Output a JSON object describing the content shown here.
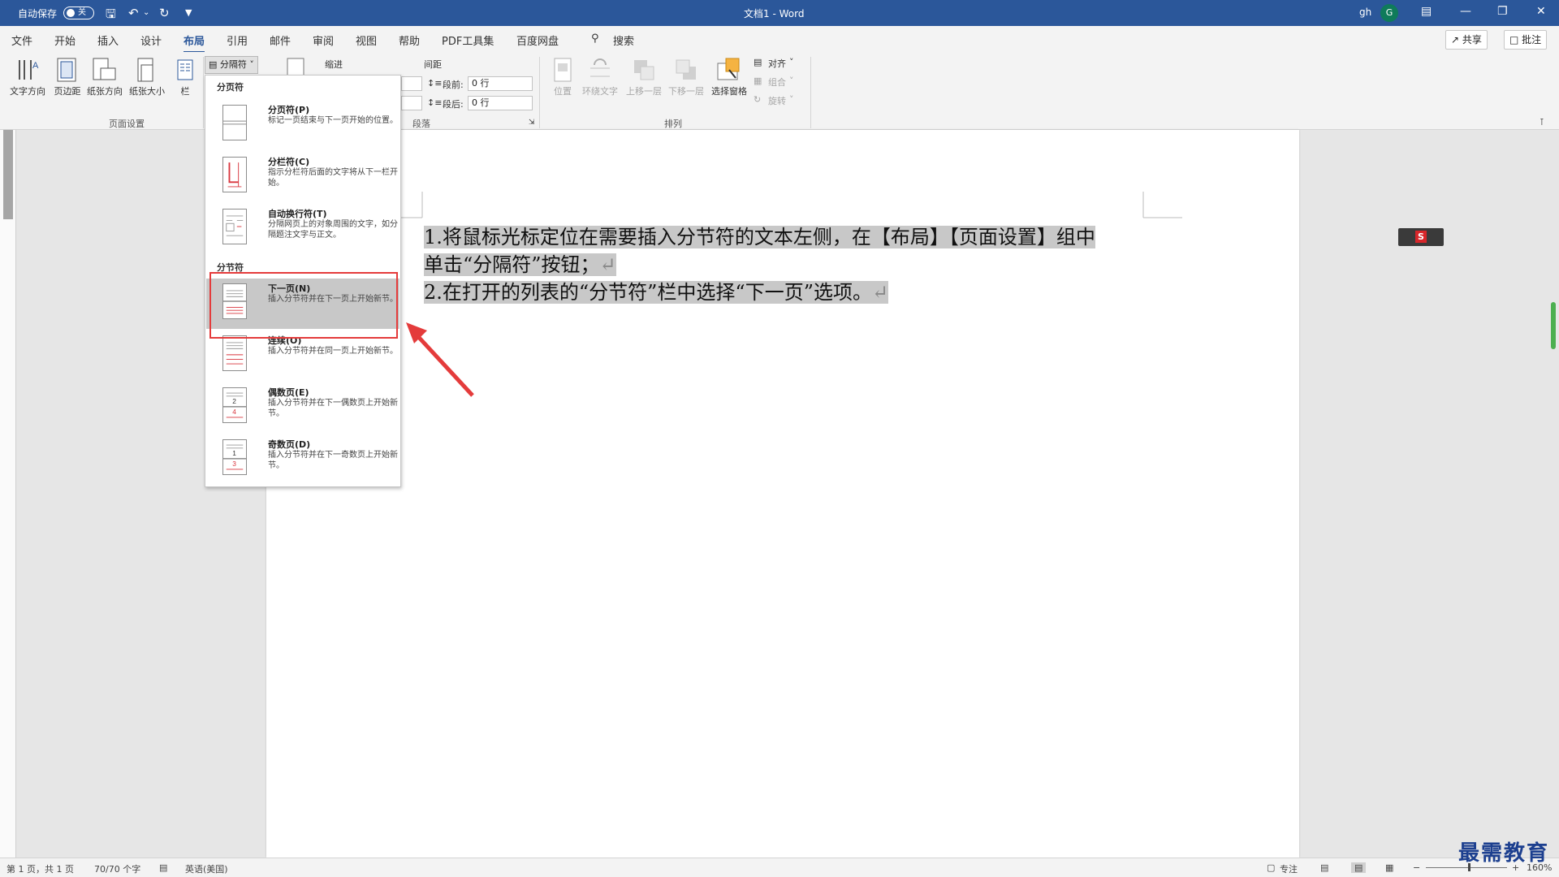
{
  "titlebar": {
    "autosave_label": "自动保存",
    "autosave_state": "关",
    "doc_title": "文档1 - Word",
    "user": "gh",
    "avatar_initial": "G"
  },
  "tabs": [
    "文件",
    "开始",
    "插入",
    "设计",
    "布局",
    "引用",
    "邮件",
    "审阅",
    "视图",
    "帮助",
    "PDF工具集",
    "百度网盘"
  ],
  "search_label": "搜索",
  "share_label": "共享",
  "comment_label": "批注",
  "ribbon": {
    "page_setup": {
      "buttons": [
        "文字方向",
        "页边距",
        "纸张方向",
        "纸张大小",
        "栏"
      ],
      "breaks_button": "分隔符",
      "group_label": "页面设置"
    },
    "paragraph": {
      "indent_label": "缩进",
      "spacing_label": "间距",
      "before_label": "段前:",
      "before_value": "0 行",
      "after_label": "段后:",
      "after_value": "0 行",
      "group_label": "段落"
    },
    "arrange": {
      "buttons": [
        "位置",
        "环绕文字",
        "上移一层",
        "下移一层",
        "选择窗格"
      ],
      "align_label": "对齐",
      "group_items_label": "组合",
      "rotate_label": "旋转",
      "group_label": "排列"
    }
  },
  "dropdown": {
    "page_breaks_header": "分页符",
    "section_breaks_header": "分节符",
    "items": [
      {
        "title": "分页符(P)",
        "desc": "标记一页结束与下一页开始的位置。"
      },
      {
        "title": "分栏符(C)",
        "desc": "指示分栏符后面的文字将从下一栏开始。"
      },
      {
        "title": "自动换行符(T)",
        "desc": "分隔网页上的对象周围的文字，如分隔题注文字与正文。"
      },
      {
        "title": "下一页(N)",
        "desc": "插入分节符并在下一页上开始新节。"
      },
      {
        "title": "连续(O)",
        "desc": "插入分节符并在同一页上开始新节。"
      },
      {
        "title": "偶数页(E)",
        "desc": "插入分节符并在下一偶数页上开始新节。"
      },
      {
        "title": "奇数页(D)",
        "desc": "插入分节符并在下一奇数页上开始新节。"
      }
    ],
    "selected_index": 3
  },
  "document": {
    "line1": "1.将鼠标光标定位在需要插入分节符的文本左侧，在【布局】【页面设置】组中",
    "line2": "单击“分隔符”按钮；",
    "line3": "2.在打开的列表的“分节符”栏中选择“下一页”选项。",
    "para_mark": "↵"
  },
  "statusbar": {
    "page": "第 1 页，共 1 页",
    "words": "70/70 个字",
    "language": "英语(美国)",
    "focus": "专注",
    "zoom": "160%"
  },
  "watermark": "最需教育",
  "colors": {
    "accent": "#2b579a",
    "highlight": "#e43b3b",
    "selection": "#c8c8c8"
  }
}
